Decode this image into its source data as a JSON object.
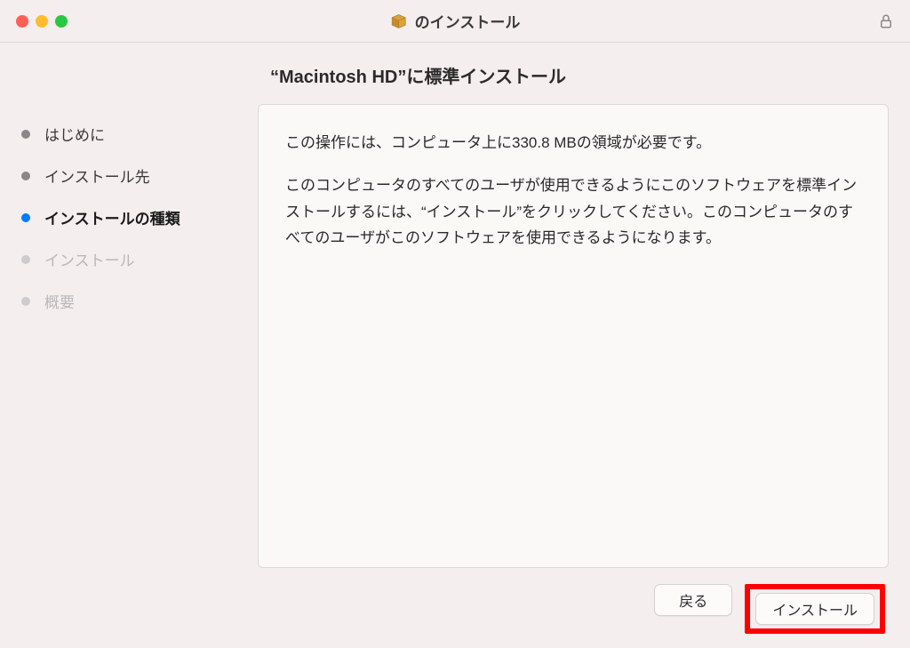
{
  "titlebar": {
    "title": "のインストール"
  },
  "sidebar": {
    "steps": [
      {
        "label": "はじめに",
        "state": "completed"
      },
      {
        "label": "インストール先",
        "state": "completed"
      },
      {
        "label": "インストールの種類",
        "state": "active"
      },
      {
        "label": "インストール",
        "state": "pending"
      },
      {
        "label": "概要",
        "state": "pending"
      }
    ]
  },
  "main": {
    "heading": "“Macintosh HD”に標準インストール",
    "paragraph1": "この操作には、コンピュータ上に330.8 MBの領域が必要です。",
    "paragraph2": "このコンピュータのすべてのユーザが使用できるようにこのソフトウェアを標準インストールするには、“インストール”をクリックしてください。このコンピュータのすべてのユーザがこのソフトウェアを使用できるようになります。"
  },
  "buttons": {
    "back": "戻る",
    "install": "インストール"
  }
}
